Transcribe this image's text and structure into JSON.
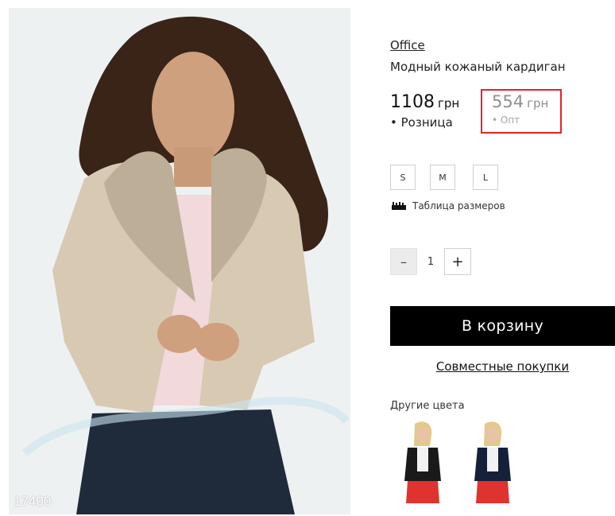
{
  "product": {
    "sku": "17400",
    "brand": "Office",
    "title": "Модный кожаный кардиган"
  },
  "price": {
    "retail": {
      "value": "1108",
      "currency": "грн",
      "label": "• Розница"
    },
    "wholesale": {
      "value": "554",
      "currency": "грн",
      "label": "• Опт"
    }
  },
  "sizes": [
    "S",
    "M",
    "L"
  ],
  "size_chart": {
    "label": "Таблица размеров",
    "icon": "ruler-icon"
  },
  "quantity": {
    "minus": "–",
    "value": "1",
    "plus": "+"
  },
  "actions": {
    "add_to_cart": "В корзину",
    "joint_purchases": "Совместные покупки"
  },
  "other_colors": {
    "title": "Другие цвета"
  },
  "colors": {
    "highlight_border": "#e2232a",
    "cart_button_bg": "#000000",
    "jacket": "#d8c9b2",
    "collar": "#bdae97"
  }
}
